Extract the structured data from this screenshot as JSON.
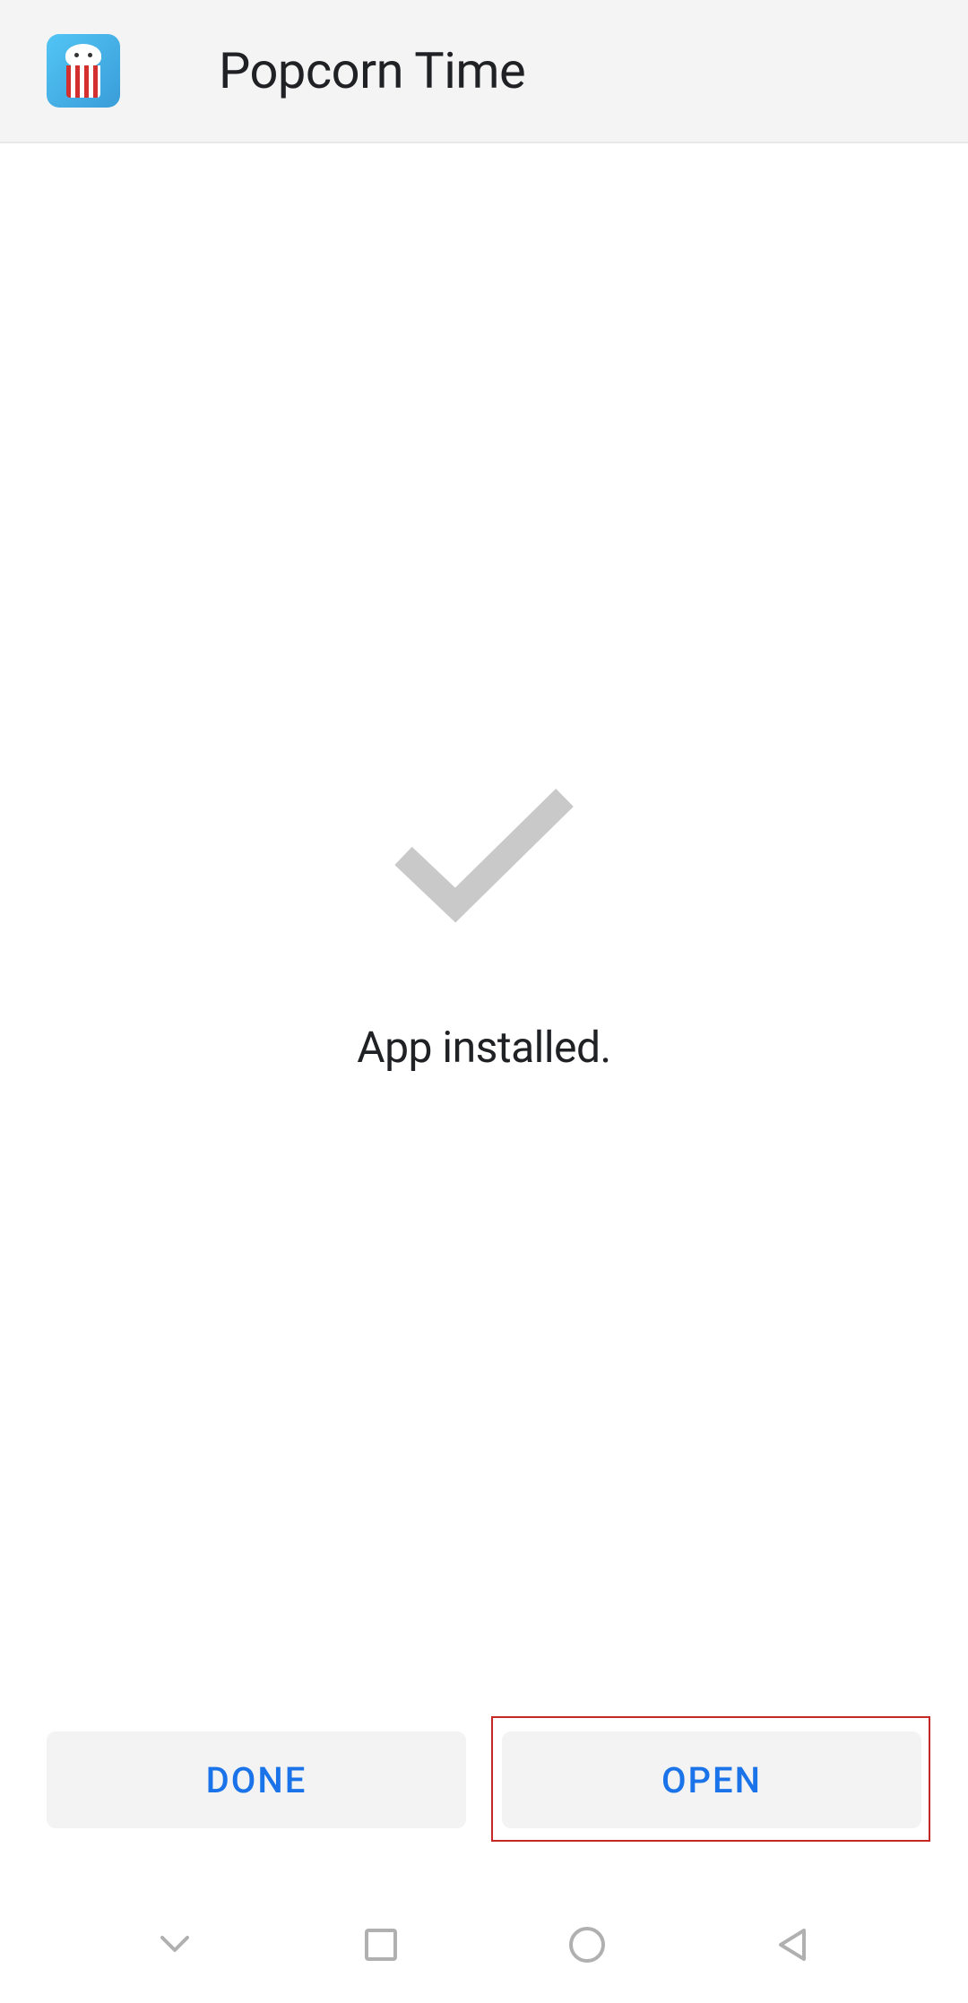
{
  "header": {
    "app_name": "Popcorn Time",
    "icon_name": "popcorn-time-app-icon"
  },
  "content": {
    "status_icon": "checkmark-icon",
    "status_text": "App installed."
  },
  "buttons": {
    "done_label": "DONE",
    "open_label": "OPEN"
  },
  "highlight": {
    "target": "open-button"
  },
  "navigation": {
    "keyboard_dismiss": "chevron-down-icon",
    "recent": "square-icon",
    "home": "circle-icon",
    "back": "triangle-back-icon"
  },
  "colors": {
    "accent": "#1a73e8",
    "highlight_border": "#c62828",
    "header_bg": "#f4f4f4",
    "button_bg": "#f3f3f3",
    "text": "#202124",
    "nav_icon": "#b0b0b0"
  }
}
